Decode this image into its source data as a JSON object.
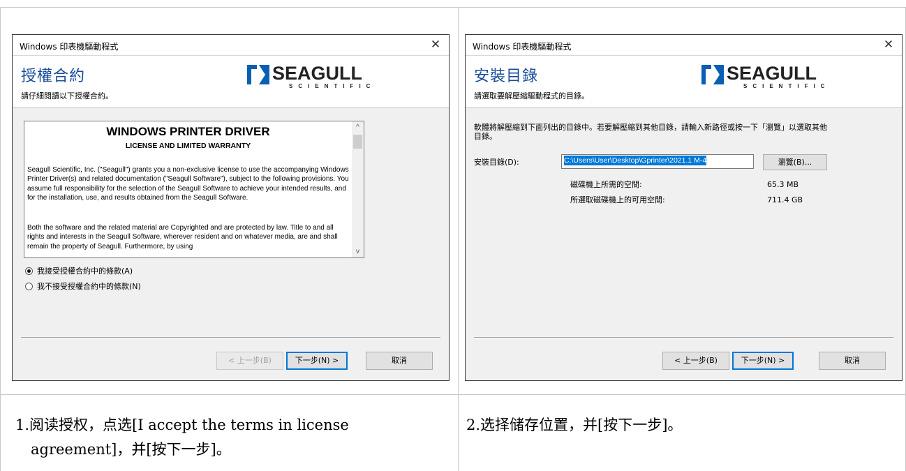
{
  "dialog_left": {
    "window_title": "Windows 印表機驅動程式",
    "close_glyph": "✕",
    "header_title": "授權合約",
    "header_subtitle": "請仔細閱讀以下授權合約。",
    "logo": {
      "word": "SEAGULL",
      "sub": "SCIENTIFIC"
    },
    "license": {
      "title": "WINDOWS PRINTER DRIVER",
      "subtitle": "LICENSE AND LIMITED WARRANTY",
      "paragraph1": "Seagull Scientific, Inc. (\"Seagull\") grants you a non-exclusive license to use the accompanying Windows Printer Driver(s) and related documentation (\"Seagull Software\"), subject to the following provisions.  You assume full responsibility for the selection of the Seagull Software to achieve your intended results, and for the installation, use, and results obtained from the Seagull Software.",
      "paragraph2": "Both the software and the related material are Copyrighted and are protected by law. Title to and all rights and interests in the Seagull Software, wherever resident and on whatever media, are and shall remain the property of Seagull. Furthermore, by using",
      "scroll_up_glyph": "^",
      "scroll_down_glyph": "v"
    },
    "radio_accept": "我接受授權合約中的條款(A)",
    "radio_decline": "我不接受授權合約中的條款(N)",
    "btn_back": "< 上一步(B)",
    "btn_next": "下一步(N) >",
    "btn_cancel": "取消"
  },
  "dialog_right": {
    "window_title": "Windows 印表機驅動程式",
    "close_glyph": "✕",
    "header_title": "安裝目錄",
    "header_subtitle": "請選取要解壓縮驅動程式的目錄。",
    "logo": {
      "word": "SEAGULL",
      "sub": "SCIENTIFIC"
    },
    "instruction": "軟體將解壓縮到下面列出的目錄中。若要解壓縮到其他目錄，請輸入新路徑或按一下「瀏覽」以選取其他目錄。",
    "dir_label": "安裝目錄(D):",
    "dir_value": "C:\\Users\\User\\Desktop\\Gprinter\\2021.1 M-4",
    "browse_btn": "瀏覽(B)...",
    "space_required_label": "磁碟機上所需的空間:",
    "space_required_value": "65.3 MB",
    "space_available_label": "所選取磁碟機上的可用空間:",
    "space_available_value": "711.4 GB",
    "btn_back": "< 上一步(B)",
    "btn_next": "下一步(N) >",
    "btn_cancel": "取消"
  },
  "captions": {
    "left_line1": "1.阅读授权，点选[I accept the terms in license",
    "left_line2": "agreement]，并[按下一步]。",
    "right": "2.选择储存位置，并[按下一步]。"
  },
  "colors": {
    "header_title": "#1a4d99",
    "selection": "#0078d7",
    "logo_blue": "#0a5fb4"
  }
}
